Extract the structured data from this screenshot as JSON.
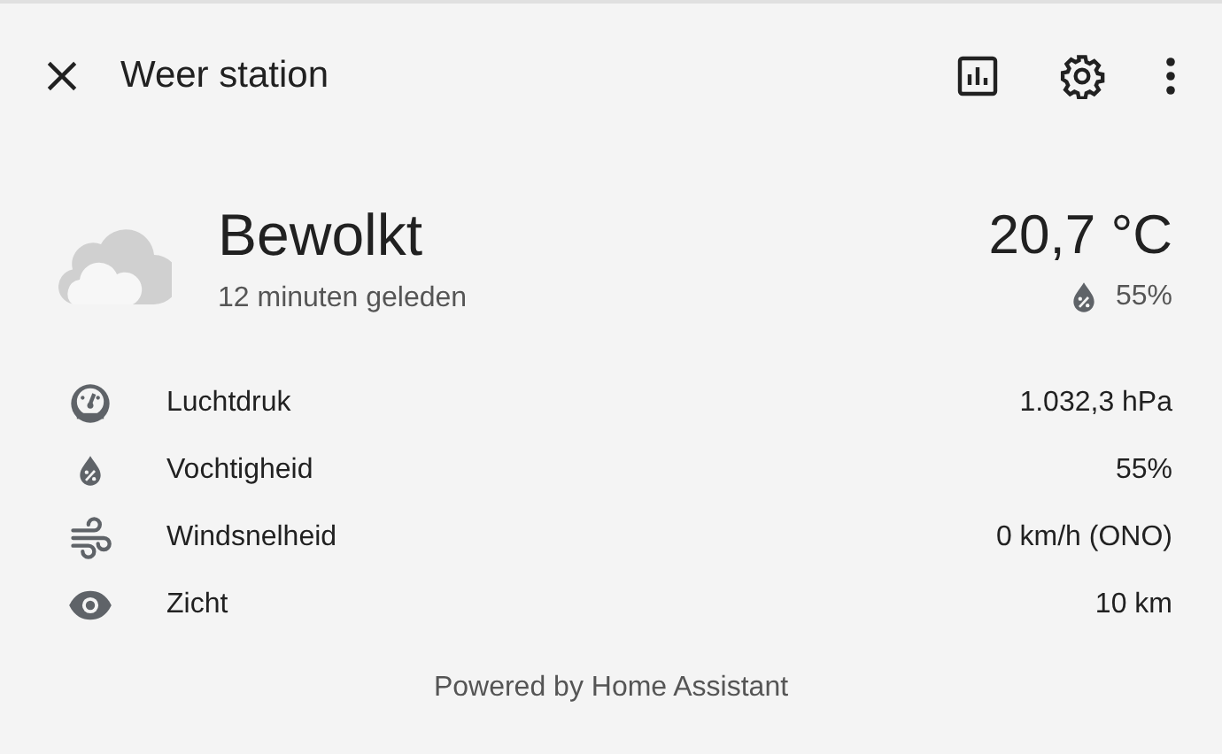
{
  "dialog": {
    "title": "Weer station"
  },
  "current": {
    "condition": "Bewolkt",
    "updated": "12 minuten geleden",
    "temperature": "20,7 °C",
    "humidity": "55%"
  },
  "attributes": [
    {
      "kind": "pressure",
      "label": "Luchtdruk",
      "value": "1.032,3 hPa"
    },
    {
      "kind": "humidity",
      "label": "Vochtigheid",
      "value": "55%"
    },
    {
      "kind": "wind",
      "label": "Windsnelheid",
      "value": "0 km/h (ONO)"
    },
    {
      "kind": "visibility",
      "label": "Zicht",
      "value": "10 km"
    }
  ],
  "footer": "Powered by Home Assistant"
}
